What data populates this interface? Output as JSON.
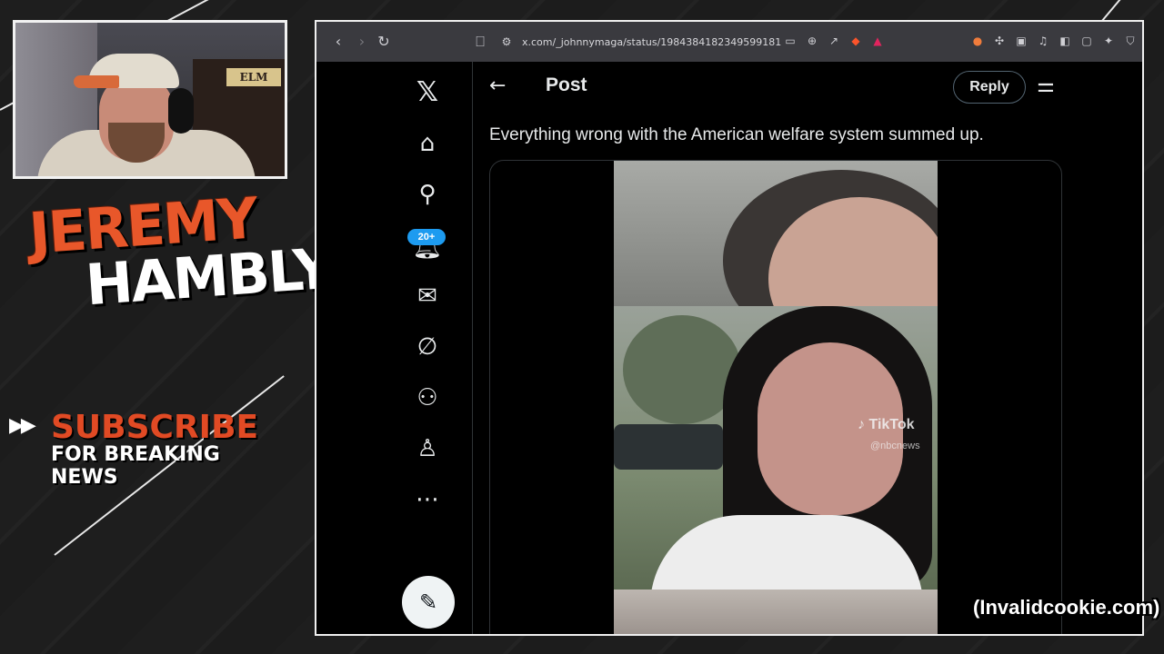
{
  "brand": {
    "first_name": "JEREMY",
    "last_name": "HAMBLY",
    "subscribe_title": "SUBSCRIBE",
    "subscribe_sub": "FOR BREAKING NEWS"
  },
  "webcam": {
    "sign_text": "ELM"
  },
  "browser": {
    "url": "x.com/_johnnymaga/status/1984384182349599181"
  },
  "x": {
    "notification_badge": "20+",
    "header_title": "Post",
    "reply_label": "Reply",
    "post_text": "Everything wrong with the American welfare system summed up.",
    "video_watermark": "TikTok",
    "video_handle": "@nbcnews"
  },
  "watermark": "(Invalidcookie.com)",
  "colors": {
    "accent_orange": "#e8572a",
    "x_blue": "#1d9bf0"
  }
}
